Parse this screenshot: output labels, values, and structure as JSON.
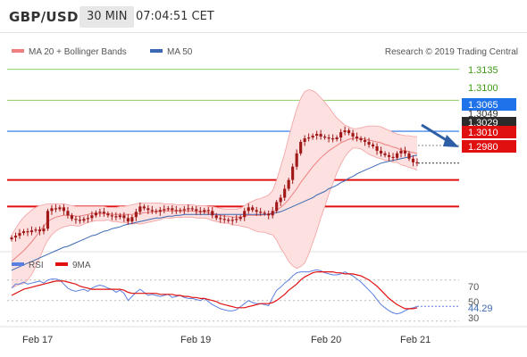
{
  "header": {
    "symbol": "GBP/USD",
    "timeframe": "30 MIN",
    "time": "07:04:51 CET"
  },
  "colors": {
    "bollinger": "#f08080",
    "band_fill": "#fde0e0",
    "ma50": "#3b6ab3",
    "candle": "#a01818",
    "green_line": "#8ccf6a",
    "green_text": "#3e9b12",
    "red_line": "#e01010",
    "blue_level": "#1f72ea",
    "pivot": "#333333",
    "arrow": "#2d5ea6",
    "rsi": "#5b7fe0",
    "rsi_ma": "#e01010"
  },
  "chart_data": [
    {
      "type": "candlestick",
      "title": "",
      "legend": [
        "MA 20 + Bollinger Bands",
        "MA 50"
      ],
      "legend_placement": "top-left",
      "watermark": "Research © 2019 Trading Central",
      "x_ticks": [
        "Feb 17",
        "Feb 19",
        "Feb 20",
        "Feb 21"
      ],
      "ylim": [
        1.2935,
        1.3175
      ],
      "levels": [
        {
          "value": 1.3135,
          "label": "1.3135",
          "style": "resistance"
        },
        {
          "value": 1.31,
          "label": "1.3100",
          "style": "resistance"
        },
        {
          "value": 1.3065,
          "label": "1.3065",
          "style": "pivot"
        },
        {
          "value": 1.3049,
          "label": "1.3049",
          "style": "dotted"
        },
        {
          "value": 1.3029,
          "label": "1.3029",
          "style": "last"
        },
        {
          "value": 1.301,
          "label": "1.3010",
          "style": "support"
        },
        {
          "value": 1.298,
          "label": "1.2980",
          "style": "support"
        }
      ],
      "close": [
        1.2945,
        1.2947,
        1.295,
        1.2952,
        1.2951,
        1.2953,
        1.2954,
        1.2952,
        1.2955,
        1.2975,
        1.2978,
        1.2977,
        1.2979,
        1.2975,
        1.297,
        1.2966,
        1.2965,
        1.2964,
        1.2966,
        1.2967,
        1.297,
        1.2973,
        1.2974,
        1.2972,
        1.297,
        1.2969,
        1.2968,
        1.297,
        1.2967,
        1.2963,
        1.2968,
        1.2974,
        1.298,
        1.2978,
        1.2976,
        1.2975,
        1.2974,
        1.2976,
        1.2977,
        1.2978,
        1.2976,
        1.2975,
        1.2976,
        1.2977,
        1.2978,
        1.2977,
        1.2975,
        1.2974,
        1.2976,
        1.2975,
        1.297,
        1.2967,
        1.2966,
        1.2965,
        1.2964,
        1.2965,
        1.2966,
        1.2968,
        1.2975,
        1.2979,
        1.2976,
        1.2974,
        1.2973,
        1.2972,
        1.297,
        1.2975,
        1.2985,
        1.299,
        1.3,
        1.301,
        1.3025,
        1.304,
        1.3053,
        1.3057,
        1.3058,
        1.306,
        1.3062,
        1.3059,
        1.3058,
        1.3057,
        1.3056,
        1.3058,
        1.3064,
        1.3066,
        1.3063,
        1.3059,
        1.3057,
        1.3055,
        1.3053,
        1.305,
        1.3048,
        1.3043,
        1.304,
        1.3038,
        1.3036,
        1.3035,
        1.304,
        1.3043,
        1.304,
        1.3034,
        1.303,
        1.3029
      ],
      "ma20": [
        1.2918,
        1.2922,
        1.2926,
        1.293,
        1.2935,
        1.294,
        1.2946,
        1.2952,
        1.2958,
        1.2963,
        1.2966,
        1.2968,
        1.2969,
        1.297,
        1.297,
        1.297,
        1.2969,
        1.2969,
        1.297,
        1.2971,
        1.2972,
        1.2972,
        1.2972,
        1.2972,
        1.2972,
        1.2971,
        1.2971,
        1.2971,
        1.2971,
        1.2971,
        1.2971,
        1.2972,
        1.2972,
        1.2973,
        1.2973,
        1.2974,
        1.2974,
        1.2975,
        1.2975,
        1.2975,
        1.2975,
        1.2975,
        1.2975,
        1.2975,
        1.2975,
        1.2975,
        1.2974,
        1.2974,
        1.2974,
        1.2973,
        1.2972,
        1.2971,
        1.297,
        1.2969,
        1.2969,
        1.2968,
        1.2968,
        1.2968,
        1.2969,
        1.297,
        1.297,
        1.297,
        1.297,
        1.2971,
        1.2971,
        1.2973,
        1.2976,
        1.2979,
        1.2983,
        1.2988,
        1.2994,
        1.3,
        1.3007,
        1.3013,
        1.3019,
        1.3025,
        1.303,
        1.3035,
        1.3039,
        1.3043,
        1.3046,
        1.3049,
        1.3052,
        1.3054,
        1.3056,
        1.3057,
        1.3057,
        1.3057,
        1.3056,
        1.3055,
        1.3054,
        1.3053,
        1.3052,
        1.305,
        1.3049,
        1.3047,
        1.3046,
        1.3044,
        1.3043,
        1.3042,
        1.3041,
        1.304
      ],
      "bb_upper": [
        1.2948,
        1.2955,
        1.2962,
        1.2968,
        1.2972,
        1.2976,
        1.2979,
        1.2981,
        1.2982,
        1.2983,
        1.2983,
        1.2983,
        1.2983,
        1.2983,
        1.2982,
        1.2981,
        1.298,
        1.298,
        1.298,
        1.298,
        1.298,
        1.298,
        1.298,
        1.298,
        1.2979,
        1.2979,
        1.2979,
        1.298,
        1.298,
        1.2981,
        1.2982,
        1.2983,
        1.2984,
        1.2984,
        1.2984,
        1.2984,
        1.2984,
        1.2984,
        1.2983,
        1.2983,
        1.2983,
        1.2982,
        1.2982,
        1.2982,
        1.2982,
        1.2982,
        1.2981,
        1.2981,
        1.2981,
        1.298,
        1.298,
        1.2979,
        1.2978,
        1.2977,
        1.2977,
        1.2977,
        1.2977,
        1.2978,
        1.2981,
        1.2984,
        1.2986,
        1.2988,
        1.2989,
        1.2991,
        1.2993,
        1.2998,
        1.301,
        1.3025,
        1.304,
        1.3058,
        1.3075,
        1.309,
        1.3102,
        1.311,
        1.3112,
        1.3111,
        1.3108,
        1.3103,
        1.3098,
        1.3092,
        1.3086,
        1.308,
        1.3076,
        1.3072,
        1.307,
        1.3068,
        1.3068,
        1.3069,
        1.307,
        1.3071,
        1.3071,
        1.3071,
        1.307,
        1.3068,
        1.3066,
        1.3064,
        1.3062,
        1.3061,
        1.306,
        1.306,
        1.3059,
        1.3059
      ],
      "bb_lower": [
        1.2888,
        1.289,
        1.2892,
        1.2893,
        1.2897,
        1.2903,
        1.2912,
        1.2922,
        1.2933,
        1.2942,
        1.2948,
        1.2952,
        1.2955,
        1.2957,
        1.2958,
        1.2959,
        1.2958,
        1.2958,
        1.296,
        1.2962,
        1.2963,
        1.2964,
        1.2964,
        1.2964,
        1.2965,
        1.2963,
        1.2963,
        1.2962,
        1.2962,
        1.2961,
        1.296,
        1.2961,
        1.296,
        1.2961,
        1.2962,
        1.2963,
        1.2964,
        1.2965,
        1.2967,
        1.2967,
        1.2967,
        1.2968,
        1.2968,
        1.2968,
        1.2968,
        1.2968,
        1.2967,
        1.2967,
        1.2967,
        1.2966,
        1.2964,
        1.2963,
        1.2962,
        1.2961,
        1.2961,
        1.2959,
        1.2959,
        1.2958,
        1.2957,
        1.2956,
        1.2954,
        1.2952,
        1.2951,
        1.2951,
        1.2949,
        1.2948,
        1.2942,
        1.2933,
        1.2926,
        1.2918,
        1.2913,
        1.291,
        1.2912,
        1.2916,
        1.2926,
        1.2939,
        1.2952,
        1.2967,
        1.298,
        1.2994,
        1.3006,
        1.3018,
        1.3028,
        1.3036,
        1.3042,
        1.3046,
        1.3046,
        1.3045,
        1.3042,
        1.3039,
        1.3037,
        1.3035,
        1.3034,
        1.3032,
        1.3032,
        1.303,
        1.303,
        1.3027,
        1.3026,
        1.3024,
        1.3023,
        1.3021
      ],
      "ma50": [
        1.2908,
        1.291,
        1.2912,
        1.2914,
        1.2916,
        1.2918,
        1.292,
        1.2922,
        1.2924,
        1.2926,
        1.2928,
        1.293,
        1.2932,
        1.2934,
        1.2935,
        1.2937,
        1.2939,
        1.2941,
        1.2943,
        1.2945,
        1.2947,
        1.2948,
        1.295,
        1.2952,
        1.2953,
        1.2955,
        1.2956,
        1.2957,
        1.2959,
        1.296,
        1.2961,
        1.2962,
        1.2963,
        1.2964,
        1.2965,
        1.2966,
        1.2967,
        1.2967,
        1.2968,
        1.2969,
        1.2969,
        1.297,
        1.297,
        1.2971,
        1.2971,
        1.2971,
        1.2971,
        1.2971,
        1.2971,
        1.2971,
        1.2971,
        1.2971,
        1.2971,
        1.2971,
        1.2971,
        1.2971,
        1.2971,
        1.2971,
        1.2971,
        1.2971,
        1.2971,
        1.2971,
        1.2971,
        1.2971,
        1.2971,
        1.2972,
        1.2973,
        1.2974,
        1.2976,
        1.2978,
        1.298,
        1.2982,
        1.2984,
        1.2986,
        1.2988,
        1.299,
        1.2993,
        1.2995,
        1.2997,
        1.3,
        1.3002,
        1.3004,
        1.3007,
        1.3009,
        1.3012,
        1.3014,
        1.3017,
        1.3019,
        1.3021,
        1.3023,
        1.3025,
        1.3027,
        1.3029,
        1.303,
        1.3031,
        1.3032,
        1.3033,
        1.3034,
        1.3035,
        1.3036,
        1.3037,
        1.3038
      ]
    },
    {
      "type": "line",
      "title": "",
      "legend": [
        "RSI",
        "9MA"
      ],
      "legend_placement": "top-left",
      "ylim": [
        28,
        75
      ],
      "y_ticks": [
        "70",
        "50",
        "30"
      ],
      "last_value_label": "44.29",
      "rsi": [
        62,
        66,
        66,
        68,
        66,
        67,
        68,
        69,
        67,
        70,
        71,
        71,
        70,
        66,
        62,
        60,
        59,
        60,
        61,
        59,
        62,
        64,
        65,
        64,
        62,
        61,
        58,
        60,
        57,
        50,
        54,
        58,
        61,
        58,
        55,
        56,
        55,
        54,
        55,
        56,
        53,
        54,
        55,
        53,
        52,
        52,
        51,
        50,
        52,
        49,
        46,
        44,
        42,
        41,
        40,
        40,
        41,
        44,
        47,
        50,
        48,
        47,
        47,
        46,
        45,
        53,
        60,
        63,
        67,
        70,
        74,
        77,
        78,
        78,
        78,
        79,
        80,
        79,
        77,
        76,
        75,
        75,
        76,
        78,
        76,
        74,
        71,
        68,
        64,
        60,
        56,
        51,
        46,
        43,
        40,
        38,
        37,
        38,
        40,
        42,
        43,
        44.29
      ],
      "ma9": [
        55,
        57,
        59,
        61,
        62,
        63,
        64,
        65,
        66,
        67,
        68,
        69,
        69,
        69,
        68,
        67,
        66,
        64,
        63,
        62,
        61,
        61,
        61,
        61,
        61,
        61,
        61,
        61,
        60,
        58,
        57,
        57,
        57,
        57,
        57,
        57,
        57,
        56,
        56,
        56,
        56,
        55,
        55,
        54,
        54,
        53,
        53,
        52,
        52,
        51,
        50,
        49,
        47,
        46,
        45,
        44,
        43,
        43,
        43,
        44,
        45,
        46,
        47,
        47,
        47,
        48,
        50,
        53,
        56,
        60,
        63,
        66,
        70,
        73,
        75,
        77,
        78,
        78,
        78,
        78,
        78,
        77,
        77,
        76,
        76,
        76,
        75,
        74,
        72,
        70,
        67,
        64,
        60,
        56,
        52,
        49,
        46,
        44,
        42,
        42,
        42,
        43
      ]
    }
  ],
  "labels": {
    "legend_bb": "MA 20 + Bollinger Bands",
    "legend_ma50": "MA 50",
    "watermark": "Research © 2019 Trading Central",
    "lvl_1": "1.3135",
    "lvl_2": "1.3100",
    "lvl_3": "1.3065",
    "lvl_4": "1.3049",
    "lvl_5": "1.3029",
    "lvl_6": "1.3010",
    "lvl_7": "1.2980",
    "rsi_legend": "RSI",
    "rsi_ma_legend": "9MA",
    "rsi_70": "70",
    "rsi_50": "50",
    "rsi_30": "30",
    "rsi_last": "44.29",
    "x_1": "Feb 17",
    "x_2": "Feb 19",
    "x_3": "Feb 20",
    "x_4": "Feb 21"
  }
}
